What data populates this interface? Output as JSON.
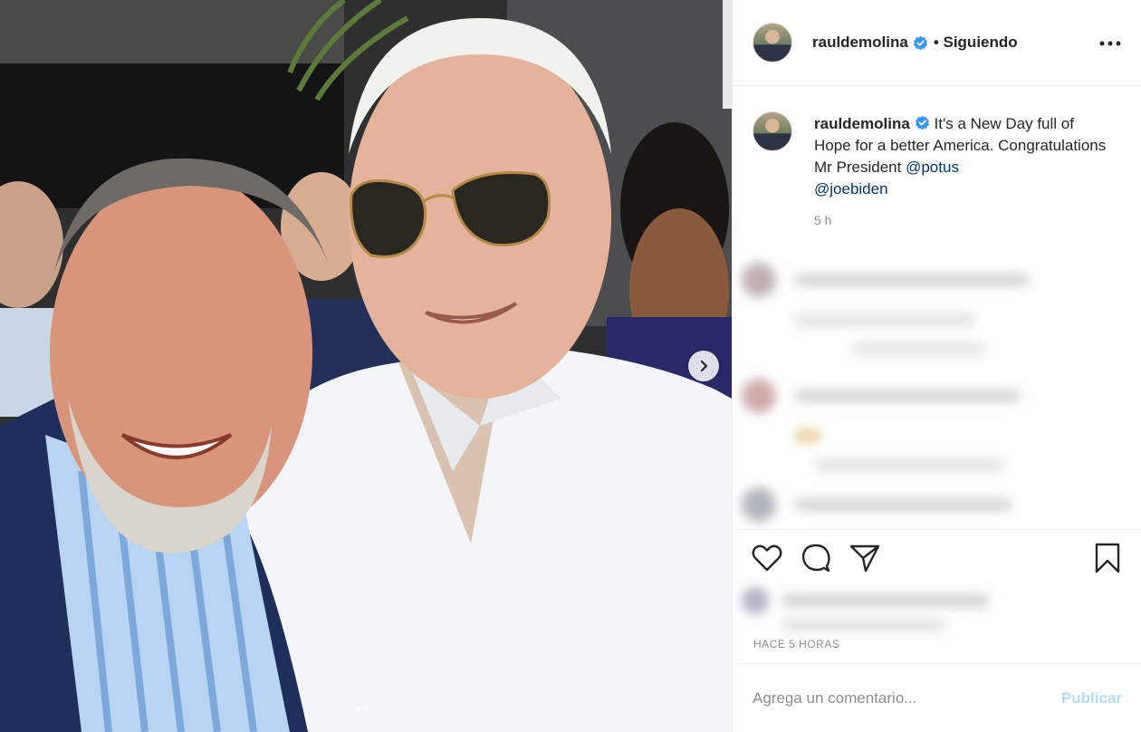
{
  "post": {
    "username": "rauldemolina",
    "follow_status": "• Siguiendo",
    "caption_text": " It's a New Day full of Hope for a better America. Congratulations Mr President ",
    "mention_1": "@potus",
    "mention_2": "@joebiden",
    "caption_time": "5 h",
    "posted_ago": "HACE 5 HORAS",
    "carousel": {
      "total": 2,
      "current": 1
    }
  },
  "comment": {
    "placeholder": "Agrega un comentario...",
    "submit_label": "Publicar"
  },
  "icons": {
    "verified": "verified-badge-icon",
    "more": "more-options-icon",
    "like": "heart-icon",
    "comment": "comment-bubble-icon",
    "share": "paper-plane-icon",
    "save": "bookmark-icon",
    "next": "chevron-right-icon"
  },
  "colors": {
    "verified_blue": "#3897f0",
    "mention": "#00376b",
    "publish_disabled": "#b2dffc",
    "secondary_text": "#8e8e8e"
  }
}
